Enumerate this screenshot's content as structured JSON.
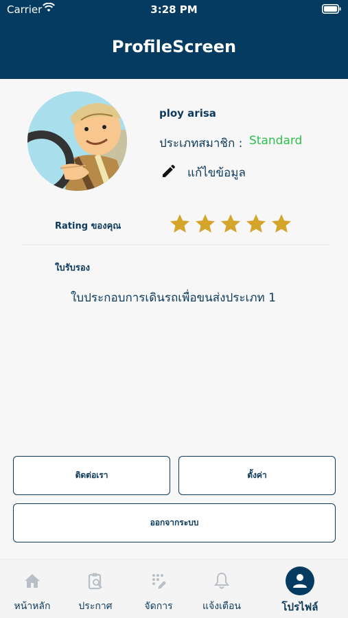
{
  "status_bar": {
    "carrier": "Carrier",
    "time": "3:28 PM"
  },
  "header": {
    "title": "ProfileScreen"
  },
  "profile": {
    "name": "ploy arisa",
    "member_type_label": "ประเภทสมาชิก :",
    "member_type_value": "Standard",
    "edit_label": "แก้ไขข้อมูล",
    "avatar_icon": "driver-avatar"
  },
  "rating": {
    "label": "Rating ของคุณ",
    "value": 5,
    "max": 5,
    "color": "#d4a52a"
  },
  "certificates": {
    "label": "ใบรับรอง",
    "items": [
      "ใบประกอบการเดินรถเพื่อขนส่งประเภท 1"
    ]
  },
  "buttons": {
    "contact": "ติดต่อเรา",
    "settings": "ตั้งค่า",
    "logout": "ออกจากระบบ"
  },
  "tabbar": {
    "items": [
      {
        "label": "หน้าหลัก",
        "icon": "home-icon",
        "active": false
      },
      {
        "label": "ประกาศ",
        "icon": "clipboard-search-icon",
        "active": false
      },
      {
        "label": "จัดการ",
        "icon": "manage-icon",
        "active": false
      },
      {
        "label": "แจ้งเตือน",
        "icon": "bell-icon",
        "active": false
      },
      {
        "label": "โปรไฟล์",
        "icon": "profile-icon",
        "active": true
      }
    ]
  },
  "colors": {
    "primary": "#053b60",
    "accent_green": "#2fbf4d",
    "star": "#d4a52a"
  }
}
